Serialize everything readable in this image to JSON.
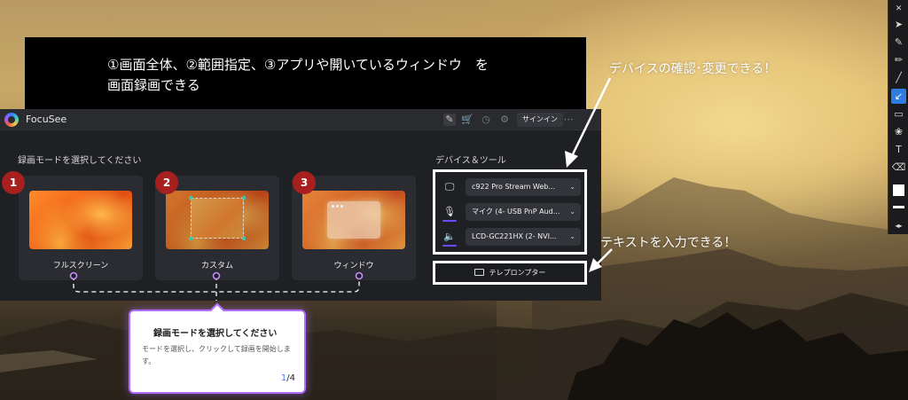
{
  "banner": {
    "line1": "①画面全体、②範囲指定、③アプリや開いているウィンドウ　を",
    "line2": "画面録画できる"
  },
  "app": {
    "name": "FocuSee",
    "signin_label": "サインイン",
    "icons": [
      "edit-icon",
      "cart-icon",
      "clock-icon",
      "gear-icon",
      "more-icon"
    ],
    "mode_section_title": "録画モードを選択してください",
    "modes": [
      {
        "number": "1",
        "label": "フルスクリーン"
      },
      {
        "number": "2",
        "label": "カスタム"
      },
      {
        "number": "3",
        "label": "ウィンドウ"
      }
    ],
    "device_section_title": "デバイス＆ツール",
    "devices": [
      {
        "icon": "monitor-webcam-icon",
        "value": "c922 Pro Stream Web..."
      },
      {
        "icon": "microphone-icon",
        "value": "マイク (4- USB PnP Aud..."
      },
      {
        "icon": "speaker-icon",
        "value": "LCD-GC221HX (2- NVI..."
      }
    ],
    "prompter_label": "テレプロンプター"
  },
  "tooltip": {
    "title": "録画モードを選択してください",
    "body": "モードを選択し、クリックして録画を開始します。",
    "step_current": "1",
    "step_total": "/4"
  },
  "annotations": {
    "device_note": "デバイスの確認･変更できる！",
    "text_note": "テキストを入力できる！"
  },
  "colors": {
    "accent_purple": "#b36cff",
    "badge_red": "#a7201f",
    "cart_orange": "#f5a623",
    "tool_active_blue": "#2e7de0"
  }
}
